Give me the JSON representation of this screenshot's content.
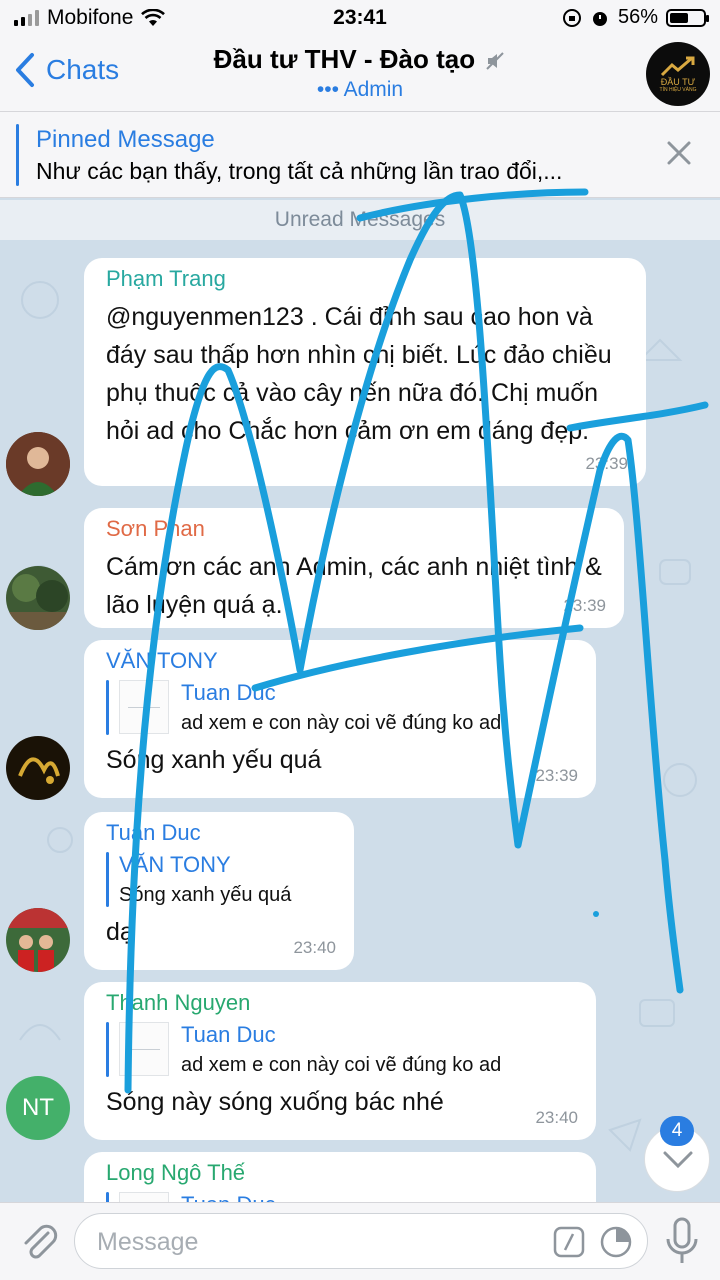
{
  "status_bar": {
    "carrier": "Mobifone",
    "time": "23:41",
    "battery": "56%"
  },
  "nav": {
    "back_label": "Chats",
    "title": "Đầu tư THV - Đào tạo",
    "subtitle": "••• Admin",
    "avatar_text": "ĐẦU TƯ",
    "avatar_subtext": "TÍN HIỆU VÀNG"
  },
  "pinned": {
    "title": "Pinned Message",
    "text": "Như các bạn thấy, trong tất cả những lần trao đổi,..."
  },
  "unread_label": "Unread Messages",
  "messages": [
    {
      "sender": "Phạm Trang",
      "name_color": "#28a8a0",
      "body": "@nguyenmen123 . Cái đỉnh sau cao hon và đáy sau thấp  hơn  nhìn  chị biết. Lúc đảo chiều phụ thuộc cả vào cây nến nữa đó. Chị muốn hỏi ad cho Chắc hơn  cảm ơn em dáng đẹp.",
      "time": "23:39"
    },
    {
      "sender": "Sơn Phan",
      "name_color": "#e06a46",
      "body": "Cám ơn các anh Admin, các anh nhiệt tình & lão luyện quá ạ.",
      "time": "23:39"
    },
    {
      "sender": "VĂN TONY",
      "name_color": "#2a7de1",
      "reply_name": "Tuan Duc",
      "reply_text": "ad xem e con này coi vẽ đúng ko ad",
      "body": "Sóng xanh yếu quá",
      "time": "23:39"
    },
    {
      "sender": "Tuan Duc",
      "name_color": "#2a7de1",
      "reply_name": "VĂN TONY",
      "reply_text": "Sóng xanh yếu quá",
      "body": "dạ",
      "time": "23:40"
    },
    {
      "sender": "Thanh Nguyen",
      "name_color": "#28a870",
      "reply_name": "Tuan Duc",
      "reply_text": "ad xem e con này coi vẽ đúng ko ad",
      "body": "Sóng này sóng xuống bác nhé",
      "time": "23:40",
      "avatar_initials": "NT"
    },
    {
      "sender": "Long Ngô Thế",
      "name_color": "#28a870",
      "reply_name": "Tuan Duc"
    }
  ],
  "input": {
    "placeholder": "Message"
  },
  "unread_badge": "4",
  "colors": {
    "accent": "#2a7de1",
    "background": "#cfdde9",
    "scribble": "#1a9fdc"
  }
}
